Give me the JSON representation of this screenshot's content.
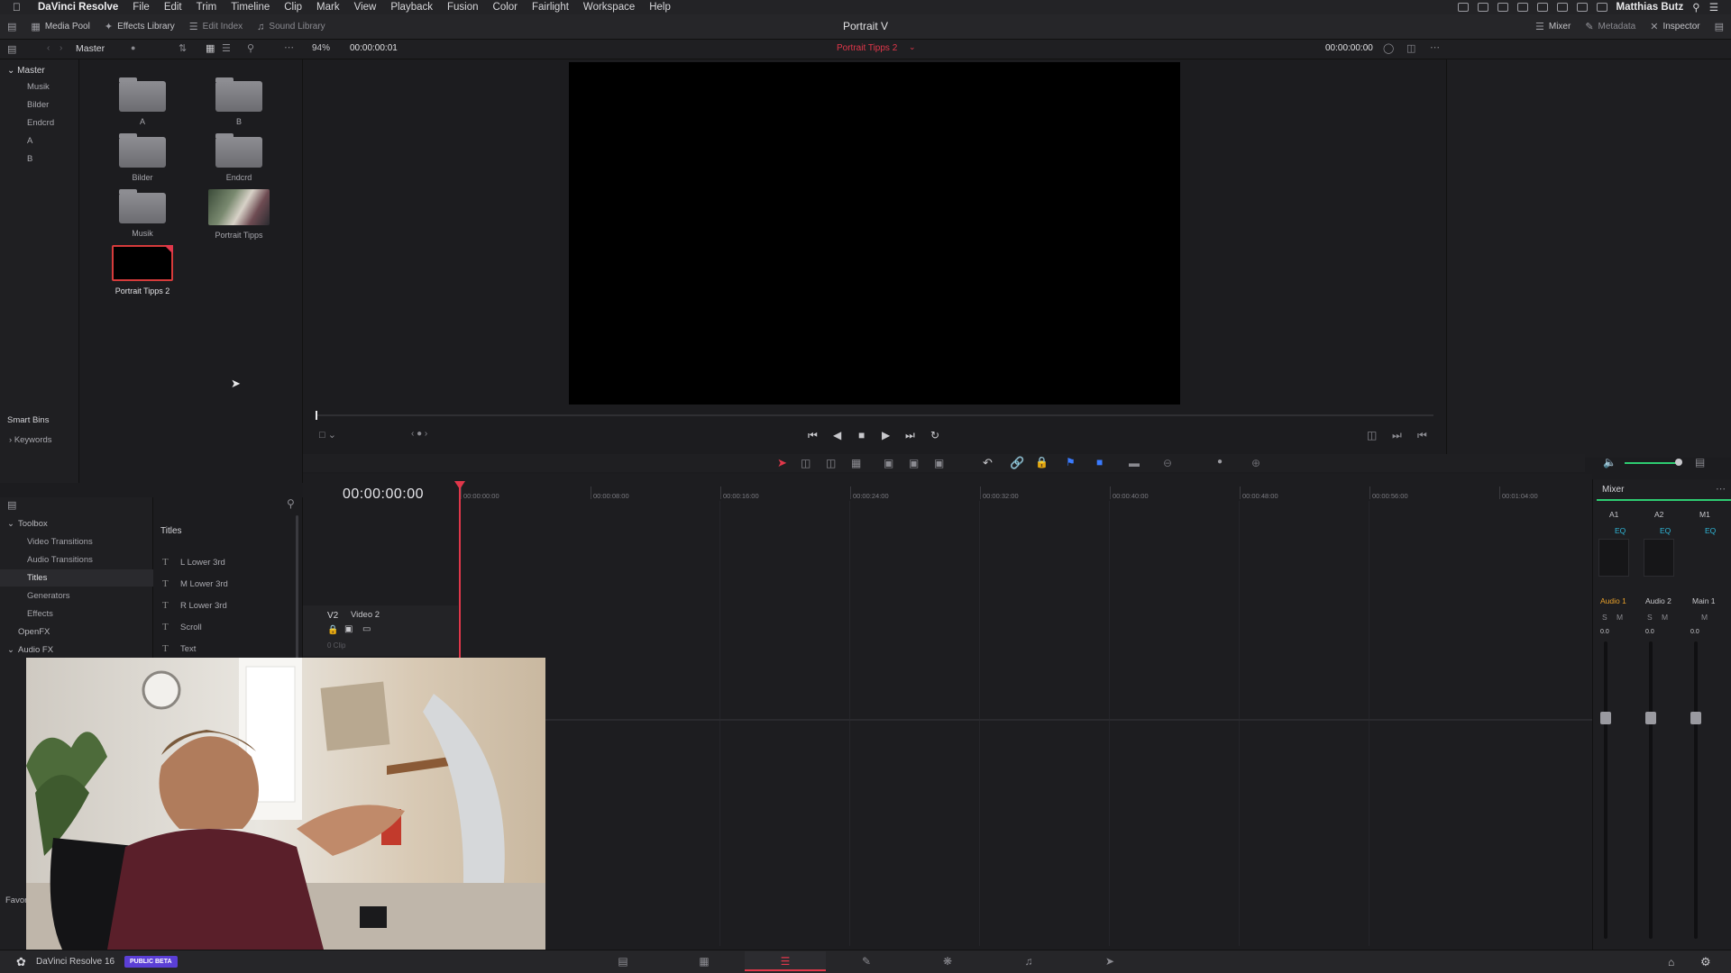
{
  "menubar": {
    "app_name": "DaVinci Resolve",
    "items": [
      "File",
      "Edit",
      "Trim",
      "Timeline",
      "Clip",
      "Mark",
      "View",
      "Playback",
      "Fusion",
      "Color",
      "Fairlight",
      "Workspace",
      "Help"
    ],
    "user": "Matthias Butz"
  },
  "toolbar": {
    "media_pool": "Media Pool",
    "effects_library": "Effects Library",
    "edit_index": "Edit Index",
    "sound_library": "Sound Library",
    "project_title": "Portrait V",
    "mixer": "Mixer",
    "metadata": "Metadata",
    "inspector": "Inspector"
  },
  "mediapool_bar": {
    "bin_name": "Master",
    "zoom": "94%",
    "source_tc": "00:00:00:01",
    "timeline_name": "Portrait Tipps 2",
    "record_tc": "00:00:00:00"
  },
  "bins": {
    "master": "Master",
    "items": [
      "Musik",
      "Bilder",
      "Endcrd",
      "A",
      "B"
    ],
    "smart_bins": "Smart Bins",
    "keywords": "Keywords"
  },
  "clips": [
    {
      "label": "A",
      "type": "folder"
    },
    {
      "label": "B",
      "type": "folder"
    },
    {
      "label": "Bilder",
      "type": "folder"
    },
    {
      "label": "Endcrd",
      "type": "folder"
    },
    {
      "label": "Musik",
      "type": "folder"
    },
    {
      "label": "Portrait Tipps",
      "type": "timeline-thumb"
    },
    {
      "label": "Portrait Tipps 2",
      "type": "timeline-selected"
    }
  ],
  "timeline": {
    "timecode": "00:00:00:00",
    "ticks": [
      "00:00:00:00",
      "00:00:08:00",
      "00:00:16:00",
      "00:00:24:00",
      "00:00:32:00",
      "00:00:40:00",
      "00:00:48:00",
      "00:00:56:00",
      "00:01:04:00"
    ],
    "track_id": "V2",
    "track_name": "Video 2",
    "track_clips": "0 Clip"
  },
  "effects": {
    "toolbox": "Toolbox",
    "items": [
      "Video Transitions",
      "Audio Transitions",
      "Titles",
      "Generators",
      "Effects"
    ],
    "openfx": "OpenFX",
    "audiofx": "Audio FX",
    "favorites": "Favor",
    "panel_title": "Titles",
    "titles": [
      "L Lower 3rd",
      "M Lower 3rd",
      "R Lower 3rd",
      "Scroll",
      "Text"
    ]
  },
  "mixer": {
    "title": "Mixer",
    "channels": [
      "A1",
      "A2",
      "M1"
    ],
    "eq": "EQ",
    "names": [
      "Audio 1",
      "Audio 2",
      "Main 1"
    ],
    "s": "S",
    "m": "M",
    "level": "0.0"
  },
  "statusbar": {
    "app_version": "DaVinci Resolve 16",
    "badge": "PUBLIC BETA"
  },
  "colors": {
    "accent": "#e0374a",
    "badge": "#5b3fd6",
    "mixer_green": "#2ecc71"
  }
}
